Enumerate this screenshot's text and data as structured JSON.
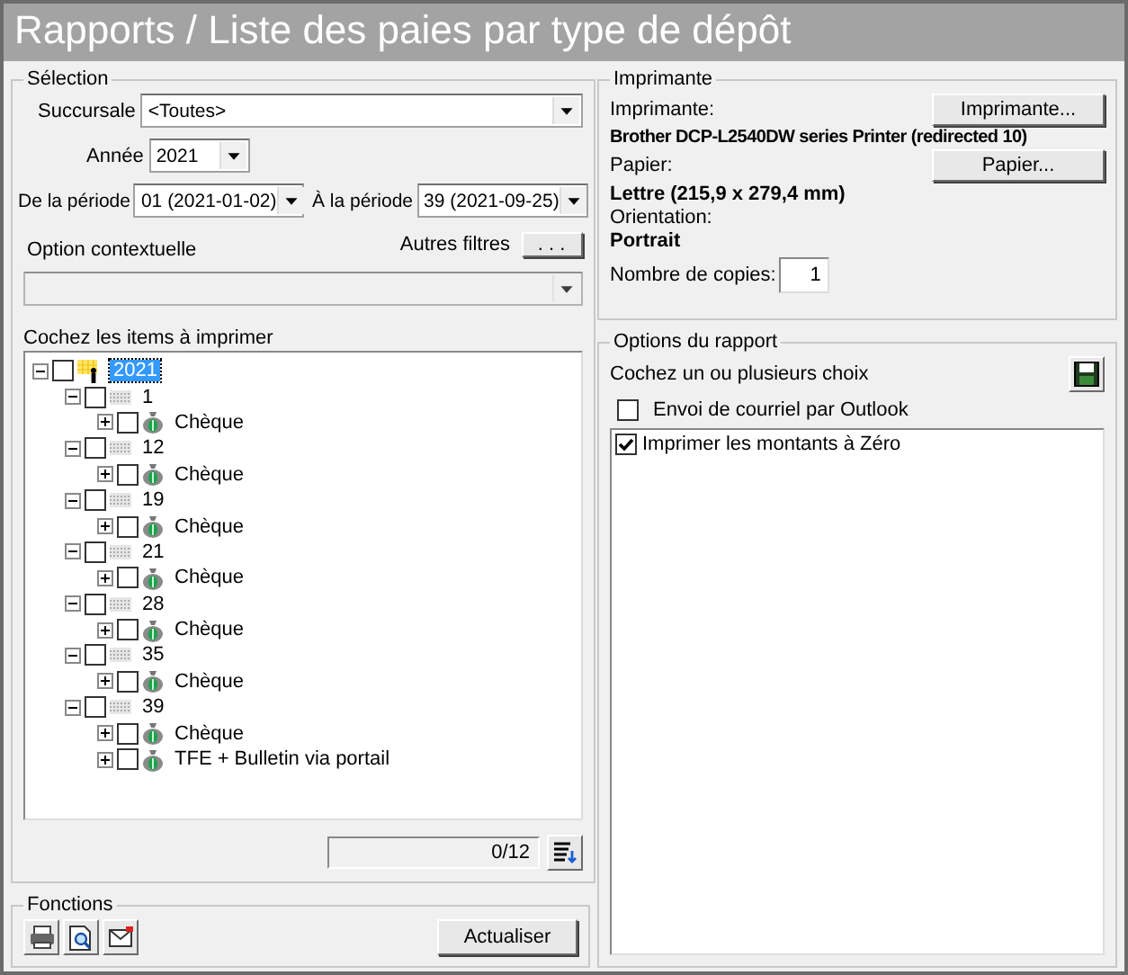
{
  "window": {
    "title": "Rapports / Liste des paies par type de dépôt"
  },
  "selection": {
    "title": "Sélection",
    "branch": {
      "label": "Succursale",
      "value": "<Toutes>"
    },
    "year": {
      "label": "Année",
      "value": "2021"
    },
    "period_from": {
      "label": "De la période",
      "value": "01 (2021-01-02)"
    },
    "period_to": {
      "label": "À la période",
      "value": "39 (2021-09-25)"
    },
    "context_option": {
      "label": "Option contextuelle",
      "disabled": true
    },
    "other_filters": {
      "label": "Autres filtres",
      "button": ". . ."
    },
    "tree_label": "Cochez les items à imprimer",
    "tree": [
      {
        "label": "2021",
        "kind": "year",
        "checked": false,
        "expanded": true,
        "selected": true,
        "children": [
          {
            "label": "1",
            "kind": "period",
            "checked": false,
            "expanded": true,
            "selected": false,
            "children": [
              {
                "label": "Chèque",
                "kind": "deposit",
                "checked": false,
                "expanded": false,
                "selected": false
              }
            ]
          },
          {
            "label": "12",
            "kind": "period",
            "checked": false,
            "expanded": true,
            "selected": false,
            "children": [
              {
                "label": "Chèque",
                "kind": "deposit",
                "checked": false,
                "expanded": false,
                "selected": false
              }
            ]
          },
          {
            "label": "19",
            "kind": "period",
            "checked": false,
            "expanded": true,
            "selected": false,
            "children": [
              {
                "label": "Chèque",
                "kind": "deposit",
                "checked": false,
                "expanded": false,
                "selected": false
              }
            ]
          },
          {
            "label": "21",
            "kind": "period",
            "checked": false,
            "expanded": true,
            "selected": false,
            "children": [
              {
                "label": "Chèque",
                "kind": "deposit",
                "checked": false,
                "expanded": false,
                "selected": false
              }
            ]
          },
          {
            "label": "28",
            "kind": "period",
            "checked": false,
            "expanded": true,
            "selected": false,
            "children": [
              {
                "label": "Chèque",
                "kind": "deposit",
                "checked": false,
                "expanded": false,
                "selected": false
              }
            ]
          },
          {
            "label": "35",
            "kind": "period",
            "checked": false,
            "expanded": true,
            "selected": false,
            "children": [
              {
                "label": "Chèque",
                "kind": "deposit",
                "checked": false,
                "expanded": false,
                "selected": false
              }
            ]
          },
          {
            "label": "39",
            "kind": "period",
            "checked": false,
            "expanded": true,
            "selected": false,
            "children": [
              {
                "label": "Chèque",
                "kind": "deposit",
                "checked": false,
                "expanded": false,
                "selected": false
              },
              {
                "label": "TFE + Bulletin via portail",
                "kind": "deposit",
                "checked": false,
                "expanded": false,
                "selected": false
              }
            ]
          }
        ]
      }
    ],
    "counter": "0/12"
  },
  "functions": {
    "title": "Fonctions",
    "refresh_button": "Actualiser"
  },
  "printer": {
    "title": "Imprimante",
    "printer_label": "Imprimante:",
    "printer_name": "Brother DCP-L2540DW series Printer (redirected 10)",
    "printer_button": "Imprimante...",
    "paper_label": "Papier:",
    "paper_value": "Lettre (215,9 x 279,4 mm)",
    "paper_button": "Papier...",
    "orientation_label": "Orientation:",
    "orientation_value": "Portrait",
    "copies_label": "Nombre de copies:",
    "copies_value": "1"
  },
  "report_options": {
    "title": "Options du rapport",
    "hint": "Cochez un ou plusieurs choix",
    "email": {
      "label": "Envoi de courriel par Outlook",
      "checked": false
    },
    "choices": [
      {
        "label": "Imprimer les montants à Zéro",
        "checked": true
      }
    ]
  }
}
